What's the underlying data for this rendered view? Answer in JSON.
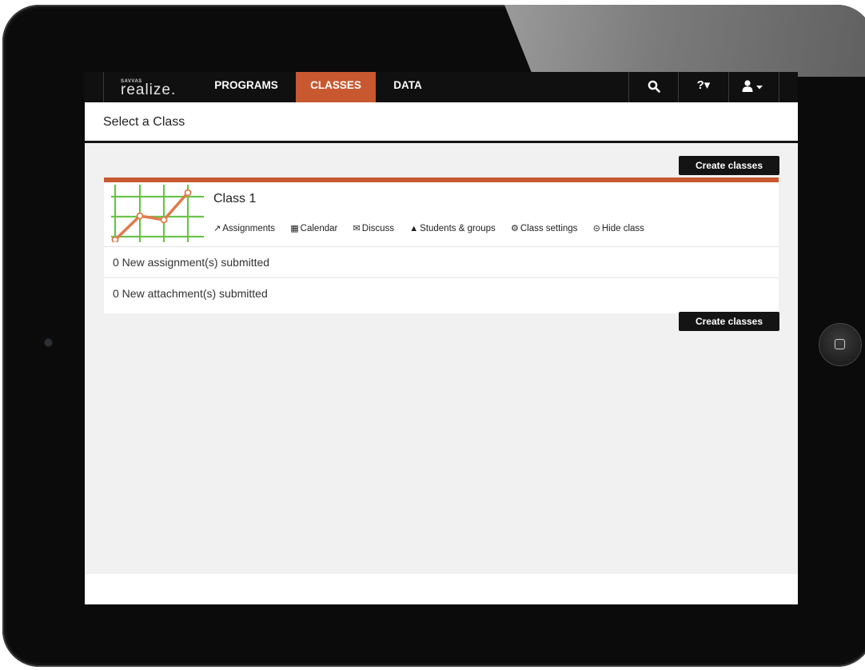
{
  "navbar": {
    "logo_brand": "SAVVAS",
    "logo_text": "realize.",
    "tabs": [
      {
        "label": "PROGRAMS"
      },
      {
        "label": "CLASSES"
      },
      {
        "label": "DATA"
      }
    ],
    "search_icon": "search-icon",
    "help_label": "?▾",
    "account_icon": "user-icon"
  },
  "page": {
    "title": "Select a Class"
  },
  "buttons": {
    "create_classes": "Create classes"
  },
  "class_card": {
    "name": "Class 1",
    "actions": [
      {
        "icon": "assignments-icon",
        "label": "Assignments"
      },
      {
        "icon": "calendar-icon",
        "label": "Calendar"
      },
      {
        "icon": "discuss-icon",
        "label": "Discuss"
      },
      {
        "icon": "user-icon",
        "label": "Students & groups"
      },
      {
        "icon": "gear-icon",
        "label": "Class settings"
      },
      {
        "icon": "minus-circle-icon",
        "label": "Hide class"
      }
    ],
    "status": [
      {
        "text": "0 New assignment(s) submitted"
      },
      {
        "text": "0 New attachment(s) submitted"
      }
    ]
  },
  "colors": {
    "accent": "#c8582f",
    "navbar": "#101010",
    "thumbnail_grid": "#6cc24a"
  }
}
